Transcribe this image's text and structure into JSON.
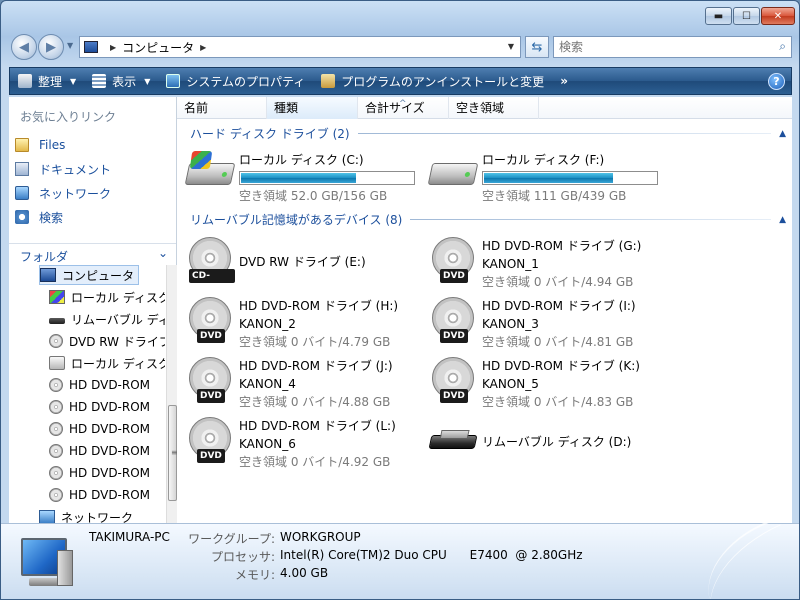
{
  "caption": {
    "minimize": "▬",
    "maximize": "☐",
    "close": "✕"
  },
  "nav": {
    "back": "◀",
    "forward": "▶",
    "address_crumbs": [
      "コンピュータ"
    ],
    "search_placeholder": "検索"
  },
  "toolbar": {
    "organize": "整理",
    "view": "表示",
    "system_properties": "システムのプロパティ",
    "uninstall": "プログラムのアンインストールと変更",
    "more": "»",
    "help": "?"
  },
  "left": {
    "favorites_title": "お気に入りリンク",
    "favorites": [
      {
        "label": "Files",
        "icon": "folder-icon"
      },
      {
        "label": "ドキュメント",
        "icon": "documents-icon"
      },
      {
        "label": "ネットワーク",
        "icon": "network-icon"
      },
      {
        "label": "検索",
        "icon": "search-icon"
      }
    ],
    "folders_title": "フォルダ",
    "tree": [
      {
        "label": "コンピュータ",
        "icon": "computer-icon",
        "selected": true
      },
      {
        "label": "ローカル ディスク (C:)",
        "icon": "local-disk-c-icon"
      },
      {
        "label": "リムーバブル ディスク (D:)",
        "icon": "removable-disk-icon"
      },
      {
        "label": "DVD RW ドライブ (E:)",
        "icon": "dvd-icon"
      },
      {
        "label": "ローカル ディスク (F:)",
        "icon": "local-disk-icon"
      },
      {
        "label": "HD DVD-ROM",
        "icon": "dvd-icon"
      },
      {
        "label": "HD DVD-ROM",
        "icon": "dvd-icon"
      },
      {
        "label": "HD DVD-ROM",
        "icon": "dvd-icon"
      },
      {
        "label": "HD DVD-ROM",
        "icon": "dvd-icon"
      },
      {
        "label": "HD DVD-ROM",
        "icon": "dvd-icon"
      },
      {
        "label": "HD DVD-ROM",
        "icon": "dvd-icon"
      },
      {
        "label": "ネットワーク",
        "icon": "network-icon"
      }
    ]
  },
  "columns": [
    "名前",
    "種類",
    "合計サイズ",
    "空き領域"
  ],
  "groups": {
    "hdd": "ハード ディスク ドライブ (2)",
    "removable": "リムーバブル記憶域があるデバイス (8)"
  },
  "hdd": [
    {
      "name": "ローカル ディスク (C:)",
      "info": "空き領域 52.0 GB/156 GB",
      "used_fraction": 0.67
    },
    {
      "name": "ローカル ディスク (F:)",
      "info": "空き領域 111 GB/439 GB",
      "used_fraction": 0.75
    }
  ],
  "devices": [
    {
      "name": "DVD RW ドライブ (E:)",
      "sub": "",
      "info": "",
      "label": "CD-ROM"
    },
    {
      "name": "HD DVD-ROM ドライブ (G:)",
      "sub": "KANON_1",
      "info": "空き領域 0 バイト/4.94 GB",
      "label": "DVD"
    },
    {
      "name": "HD DVD-ROM ドライブ (H:)",
      "sub": "KANON_2",
      "info": "空き領域 0 バイト/4.79 GB",
      "label": "DVD"
    },
    {
      "name": "HD DVD-ROM ドライブ (I:)",
      "sub": "KANON_3",
      "info": "空き領域 0 バイト/4.81 GB",
      "label": "DVD"
    },
    {
      "name": "HD DVD-ROM ドライブ (J:)",
      "sub": "KANON_4",
      "info": "空き領域 0 バイト/4.88 GB",
      "label": "DVD"
    },
    {
      "name": "HD DVD-ROM ドライブ (K:)",
      "sub": "KANON_5",
      "info": "空き領域 0 バイト/4.83 GB",
      "label": "DVD"
    },
    {
      "name": "HD DVD-ROM ドライブ (L:)",
      "sub": "KANON_6",
      "info": "空き領域 0 バイト/4.92 GB",
      "label": "DVD"
    },
    {
      "name": "リムーバブル ディスク (D:)",
      "sub": "",
      "info": "",
      "label": ""
    }
  ],
  "details": {
    "pc_name": "TAKIMURA-PC",
    "workgroup_label": "ワークグループ:",
    "workgroup": "WORKGROUP",
    "processor_label": "プロセッサ:",
    "processor": "Intel(R) Core(TM)2 Duo CPU      E7400  @ 2.80GHz",
    "memory_label": "メモリ:",
    "memory": "4.00 GB"
  }
}
